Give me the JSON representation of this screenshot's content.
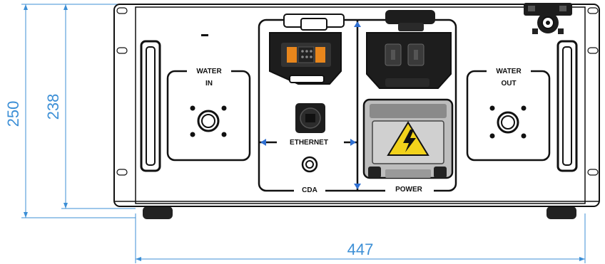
{
  "dimensions": {
    "overall_height": "250",
    "panel_height": "238",
    "overall_width": "447"
  },
  "panel": {
    "water_in_label": [
      "WATER",
      "IN"
    ],
    "water_out_label": [
      "WATER",
      "OUT"
    ],
    "ethernet_label": "ETHERNET",
    "cda_label": "CDA",
    "power_label": "POWER"
  },
  "colors": {
    "dimension_line": "#3c8fd6",
    "outline": "#111111",
    "connector_accent": "#e8861c",
    "warning_yellow": "#f2d21b",
    "divider_blue": "#2f6fd1"
  }
}
